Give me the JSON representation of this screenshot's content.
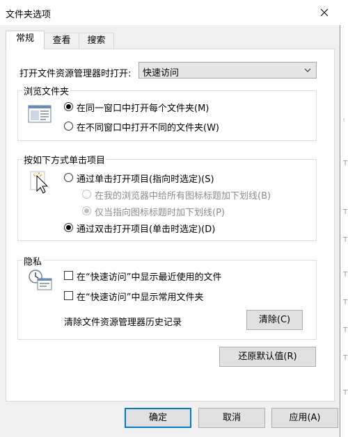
{
  "window": {
    "title": "文件夹选项"
  },
  "tabs": [
    {
      "label": "常规",
      "active": true
    },
    {
      "label": "查看",
      "active": false
    },
    {
      "label": "搜索",
      "active": false
    }
  ],
  "general": {
    "open_label": "打开文件资源管理器时打开:",
    "open_value": "快速访问",
    "browse": {
      "title": "浏览文件夹",
      "same_window": "在同一窗口中打开每个文件夹(M)",
      "new_window": "在不同窗口中打开不同的文件夹(W)",
      "selected": "same_window"
    },
    "click": {
      "title": "按如下方式单击项目",
      "single": "通过单击打开项目(指向时选定)(S)",
      "underline_all": "在我的浏览器中给所有图标标题加下划线(B)",
      "underline_point": "仅当指向图标标题时加下划线(P)",
      "double": "通过双击打开项目(单击时选定)(D)",
      "selected": "double"
    },
    "privacy": {
      "title": "隐私",
      "recent_files": "在“快速访问”中显示最近使用的文件",
      "frequent_folders": "在“快速访问”中显示常用文件夹",
      "clear_label": "清除文件资源管理器历史记录",
      "clear_button": "清除(C)"
    },
    "restore_button": "还原默认值(R)"
  },
  "footer": {
    "ok": "确定",
    "cancel": "取消",
    "apply": "应用(A)"
  },
  "background_marks": [
    "ᵗ",
    "T",
    "T",
    "T",
    "T",
    "T",
    "T",
    "T",
    "T"
  ]
}
